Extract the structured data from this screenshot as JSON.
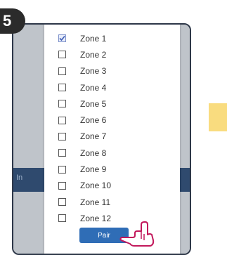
{
  "step": {
    "number": "5"
  },
  "background": {
    "band_label": "In"
  },
  "zones": [
    {
      "label": "Zone 1",
      "checked": true
    },
    {
      "label": "Zone 2",
      "checked": false
    },
    {
      "label": "Zone 3",
      "checked": false
    },
    {
      "label": "Zone 4",
      "checked": false
    },
    {
      "label": "Zone 5",
      "checked": false
    },
    {
      "label": "Zone 6",
      "checked": false
    },
    {
      "label": "Zone 7",
      "checked": false
    },
    {
      "label": "Zone 8",
      "checked": false
    },
    {
      "label": "Zone 9",
      "checked": false
    },
    {
      "label": "Zone 10",
      "checked": false
    },
    {
      "label": "Zone 11",
      "checked": false
    },
    {
      "label": "Zone 12",
      "checked": false
    }
  ],
  "pair_button": {
    "label": "Pair"
  },
  "colors": {
    "accent": "#2f6db6",
    "badge": "#2b2b2b",
    "arrow": "#f9dc7f"
  },
  "icons": {
    "hand": "pointing-hand-icon",
    "check": "checkmark-icon"
  }
}
